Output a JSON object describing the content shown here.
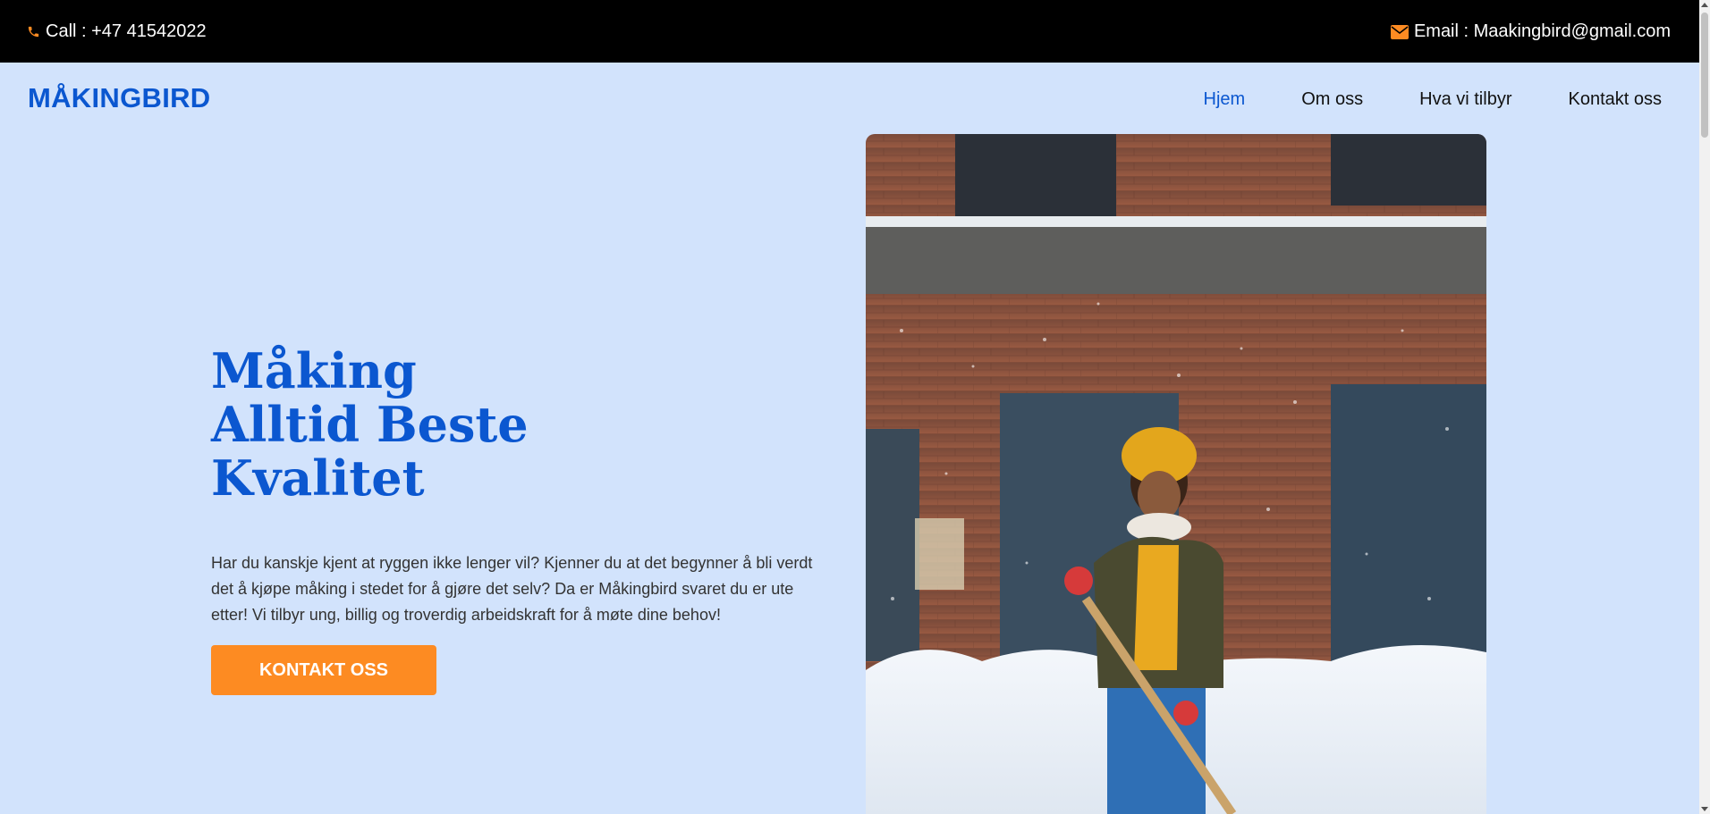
{
  "topbar": {
    "call_text": "Call : +47 41542022",
    "email_text": "Email : Maakingbird@gmail.com",
    "icon_color": "#fd8b22"
  },
  "nav": {
    "brand": "MÅKINGBIRD",
    "items": [
      {
        "label": "Hjem",
        "active": true
      },
      {
        "label": "Om oss",
        "active": false
      },
      {
        "label": "Hva vi tilbyr",
        "active": false
      },
      {
        "label": "Kontakt oss",
        "active": false
      }
    ]
  },
  "hero": {
    "title_lines": [
      "Måking",
      "Alltid Beste",
      "Kvalitet"
    ],
    "description": "Har du kanskje kjent at ryggen ikke lenger vil? Kjenner du at det begynner å bli verdt det å kjøpe måking i stedet for å gjøre det selv? Da er Måkingbird svaret du er ute etter! Vi tilbyr ung, billig og troverdig arbeidskraft for å møte dine behov!",
    "cta_label": "KONTAKT OSS"
  },
  "icons": {
    "phone": "phone-icon",
    "email": "envelope-icon"
  },
  "colors": {
    "brand_blue": "#0b57d0",
    "accent_orange": "#fd8b22",
    "page_background": "#d2e3fc",
    "topbar_background": "#000000"
  }
}
